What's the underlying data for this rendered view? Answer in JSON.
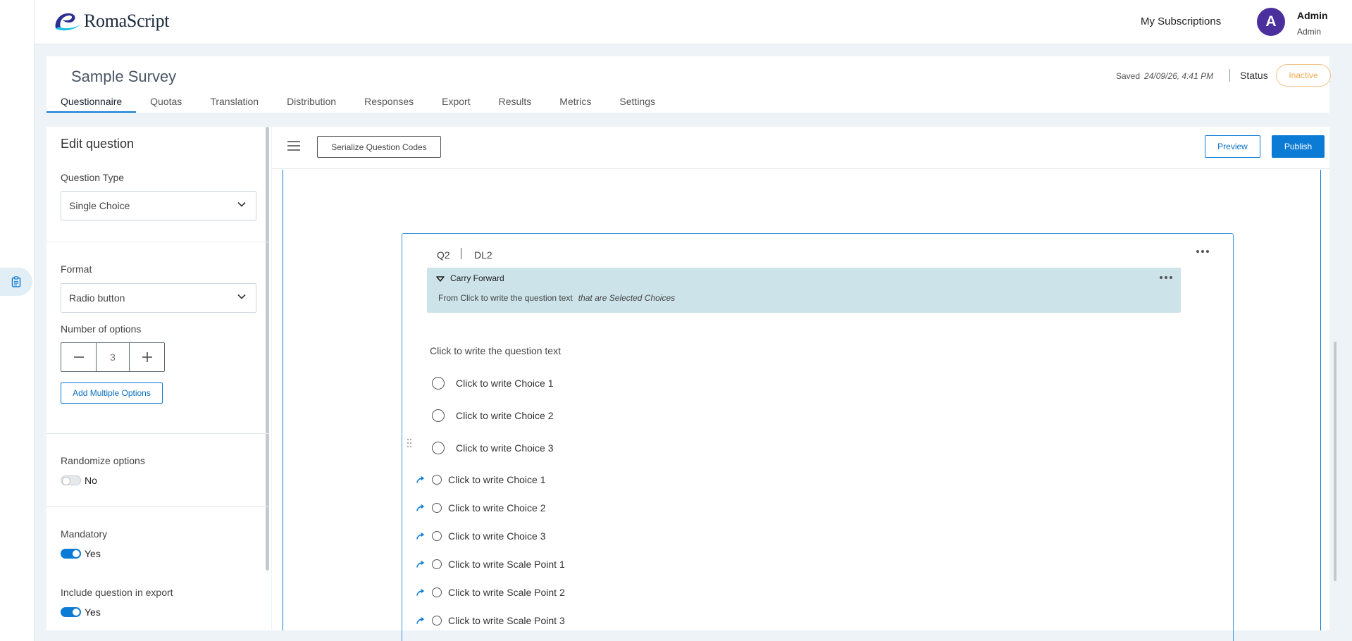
{
  "app": {
    "name": "RomaScript"
  },
  "header": {
    "subscriptions_label": "My Subscriptions",
    "user": {
      "initial": "A",
      "name": "Admin",
      "role": "Admin"
    }
  },
  "survey": {
    "title": "Sample Survey",
    "saved_label": "Saved",
    "saved_time": "24/09/26, 4:41 PM",
    "status_label": "Status",
    "status_value": "Inactive",
    "tabs": [
      {
        "label": "Questionnaire",
        "active": true
      },
      {
        "label": "Quotas"
      },
      {
        "label": "Translation"
      },
      {
        "label": "Distribution"
      },
      {
        "label": "Responses"
      },
      {
        "label": "Export"
      },
      {
        "label": "Results"
      },
      {
        "label": "Metrics"
      },
      {
        "label": "Settings"
      }
    ]
  },
  "edit_panel": {
    "title": "Edit question",
    "question_type_label": "Question Type",
    "question_type_value": "Single Choice",
    "format_label": "Format",
    "format_value": "Radio button",
    "num_options_label": "Number of options",
    "num_options_value": "3",
    "add_multiple_label": "Add Multiple Options",
    "randomize_label": "Randomize options",
    "randomize_value": "No",
    "mandatory_label": "Mandatory",
    "mandatory_value": "Yes",
    "include_export_label": "Include question in export",
    "include_export_value": "Yes"
  },
  "toolbar": {
    "serialize_label": "Serialize Question Codes",
    "preview_label": "Preview",
    "publish_label": "Publish"
  },
  "question": {
    "code": "Q2",
    "id": "DL2",
    "carry_forward": {
      "title": "Carry Forward",
      "from_text": "From Click to write the question text",
      "condition_text": "that are Selected Choices"
    },
    "text": "Click to write the question text",
    "choices": [
      "Click to write Choice 1",
      "Click to write Choice 2",
      "Click to write Choice 3"
    ],
    "carried_choices": [
      "Click to write Choice 1",
      "Click to write Choice 2",
      "Click to write Choice 3",
      "Click to write Scale Point 1",
      "Click to write Scale Point 2",
      "Click to write Scale Point 3"
    ]
  },
  "icons": {
    "accent_color": "#0b7bd5",
    "status_color": "#f0a850"
  }
}
